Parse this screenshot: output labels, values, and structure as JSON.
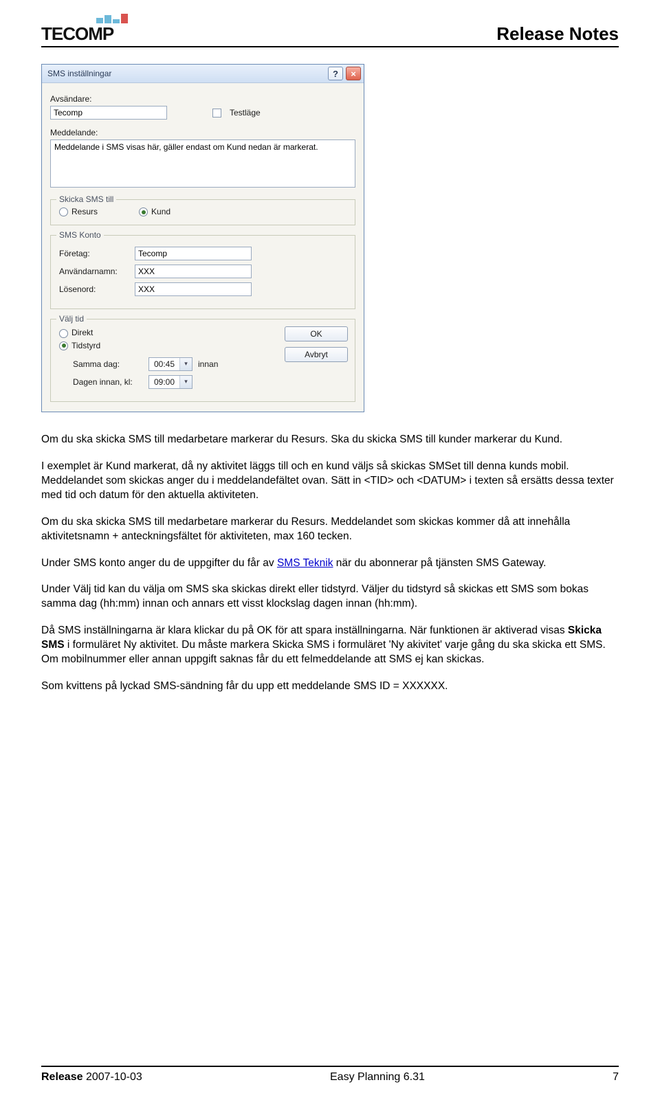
{
  "header": {
    "logo_text": "TECOMP",
    "title": "Release Notes"
  },
  "dialog": {
    "title": "SMS inställningar",
    "help_label": "?",
    "close_label": "×",
    "avsandare_label": "Avsändare:",
    "avsandare_value": "Tecomp",
    "testlage_label": "Testläge",
    "meddelande_label": "Meddelande:",
    "meddelande_value": "Meddelande i SMS visas här, gäller endast om Kund nedan är markerat.",
    "skicka_till": {
      "legend": "Skicka SMS till",
      "resurs": "Resurs",
      "kund": "Kund"
    },
    "konto": {
      "legend": "SMS Konto",
      "foretag_label": "Företag:",
      "foretag_value": "Tecomp",
      "anvandarnamn_label": "Användarnamn:",
      "anvandarnamn_value": "XXX",
      "losenord_label": "Lösenord:",
      "losenord_value": "XXX"
    },
    "valj_tid": {
      "legend": "Välj tid",
      "direkt": "Direkt",
      "tidstyrd": "Tidstyrd",
      "samma_dag_label": "Samma dag:",
      "samma_dag_value": "00:45",
      "innan": "innan",
      "dagen_innan_label": "Dagen innan, kl:",
      "dagen_innan_value": "09:00"
    },
    "ok": "OK",
    "avbryt": "Avbryt"
  },
  "body": {
    "p1": "Om du ska skicka SMS till medarbetare markerar du Resurs. Ska du skicka SMS till kunder markerar du Kund.",
    "p2": "I exemplet är Kund markerat, då ny aktivitet läggs till och en kund väljs så skickas SMSet till denna kunds mobil. Meddelandet som skickas anger du i meddelandefältet ovan. Sätt in <TID> och <DATUM> i texten så ersätts dessa texter med tid och datum för den aktuella aktiviteten.",
    "p3": "Om du ska skicka SMS till medarbetare markerar du Resurs. Meddelandet som skickas kommer då att innehålla aktivitetsnamn + anteckningsfältet för aktiviteten, max 160 tecken.",
    "p4a": "Under SMS konto anger du de uppgifter du får av ",
    "p4_link": "SMS Teknik",
    "p4b": " när du abonnerar på tjänsten SMS Gateway.",
    "p5": "Under Välj tid kan du välja om SMS ska skickas direkt eller tidstyrd. Väljer du tidstyrd så skickas ett SMS som bokas samma dag (hh:mm) innan och annars ett visst klockslag dagen innan (hh:mm).",
    "p6a": "Då SMS inställningarna är klara klickar du på OK för att spara inställningarna. När funktionen är aktiverad visas ",
    "p6_bold": "Skicka SMS",
    "p6b": " i formuläret Ny aktivitet. Du måste markera Skicka SMS i formuläret 'Ny akivitet' varje gång du ska skicka ett SMS. Om mobilnummer eller annan uppgift saknas får du ett felmeddelande att SMS ej kan skickas.",
    "p7": "Som kvittens på lyckad SMS-sändning får du upp ett meddelande SMS ID = XXXXXX."
  },
  "footer": {
    "release_label": "Release",
    "release_date": "2007-10-03",
    "product": "Easy Planning 6.31",
    "page": "7"
  }
}
